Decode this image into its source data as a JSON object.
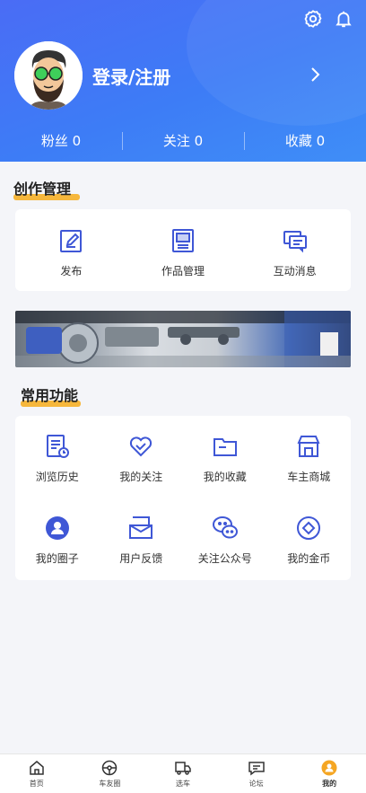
{
  "header": {
    "login_label": "登录/注册",
    "stats": [
      {
        "label": "粉丝",
        "value": "0"
      },
      {
        "label": "关注",
        "value": "0"
      },
      {
        "label": "收藏",
        "value": "0"
      }
    ],
    "stat_texts": [
      "粉丝 0",
      "关注 0",
      "收藏 0"
    ],
    "icons": [
      "settings-icon",
      "bell-icon",
      "chevron-right-icon"
    ]
  },
  "creation": {
    "title": "创作管理",
    "items": [
      {
        "label": "发布",
        "icon": "edit-icon"
      },
      {
        "label": "作品管理",
        "icon": "works-icon"
      },
      {
        "label": "互动消息",
        "icon": "messages-icon"
      }
    ]
  },
  "common": {
    "title": "常用功能",
    "items": [
      {
        "label": "浏览历史",
        "icon": "history-icon"
      },
      {
        "label": "我的关注",
        "icon": "heart-icon"
      },
      {
        "label": "我的收藏",
        "icon": "folder-icon"
      },
      {
        "label": "车主商城",
        "icon": "shop-icon"
      },
      {
        "label": "我的圈子",
        "icon": "circle-user-icon"
      },
      {
        "label": "用户反馈",
        "icon": "feedback-icon"
      },
      {
        "label": "关注公众号",
        "icon": "wechat-icon"
      },
      {
        "label": "我的金币",
        "icon": "coin-icon"
      }
    ]
  },
  "tabbar": {
    "items": [
      {
        "label": "首页",
        "icon": "home-icon"
      },
      {
        "label": "车友圈",
        "icon": "steering-wheel-icon"
      },
      {
        "label": "选车",
        "icon": "truck-icon"
      },
      {
        "label": "论坛",
        "icon": "forum-icon"
      },
      {
        "label": "我的",
        "icon": "profile-icon"
      }
    ],
    "active_index": 4
  },
  "colors": {
    "accent": "#3f6cf0",
    "highlight": "#f6b73c",
    "active_tab": "#f5a623"
  }
}
